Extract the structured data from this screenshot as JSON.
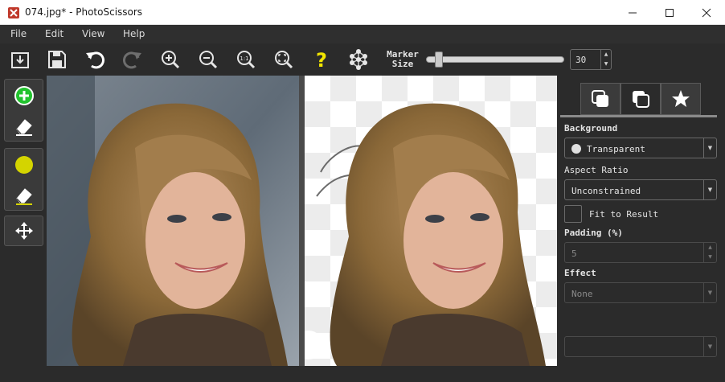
{
  "window": {
    "title": "074.jpg* - PhotoScissors",
    "minimize_icon": "minimize-icon",
    "maximize_icon": "maximize-icon",
    "close_icon": "close-icon"
  },
  "menu": {
    "items": [
      "File",
      "Edit",
      "View",
      "Help"
    ]
  },
  "toolbar": {
    "icons": [
      "open-icon",
      "save-icon",
      "undo-icon",
      "redo-icon",
      "zoom-in-icon",
      "zoom-out-icon",
      "actual-size-icon",
      "fit-icon",
      "help-icon",
      "network-icon"
    ],
    "marker_size_label_line1": "Marker",
    "marker_size_label_line2": "Size",
    "marker_size_value": "30",
    "marker_size_fraction": 0.07
  },
  "tools": {
    "icons": [
      "add-foreground-icon",
      "eraser-icon",
      "background-marker-icon",
      "background-eraser-icon",
      "move-icon"
    ],
    "accent_green": "#22c32e",
    "accent_yellow": "#d4d400"
  },
  "panel": {
    "tabs": [
      "foreground-tab-icon",
      "background-tab-icon",
      "favorites-star-icon"
    ],
    "background_label": "Background",
    "background_value": "Transparent",
    "aspect_label": "Aspect Ratio",
    "aspect_value": "Unconstrained",
    "fit_to_result_label": "Fit to Result",
    "padding_label": "Padding (%)",
    "padding_value": "5",
    "effect_label": "Effect",
    "effect_value": "None",
    "extra_value": ""
  }
}
